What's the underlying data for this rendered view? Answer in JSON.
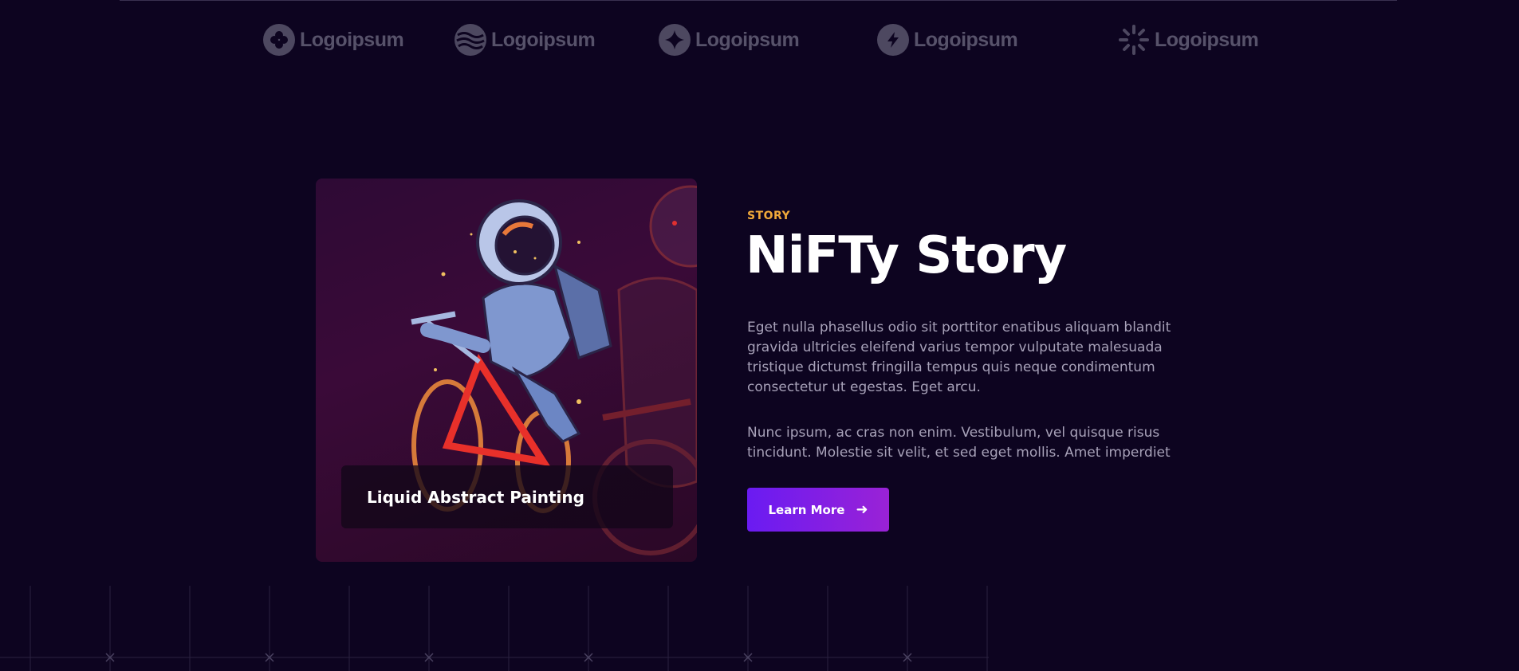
{
  "logos": [
    {
      "name": "Logoipsum",
      "icon": "clover-icon"
    },
    {
      "name": "Logoipsum",
      "icon": "waves-icon"
    },
    {
      "name": "Logoipsum",
      "icon": "star-icon"
    },
    {
      "name": "Logoipsum",
      "icon": "bolt-icon"
    },
    {
      "name": "Logoipsum",
      "icon": "sun-icon"
    }
  ],
  "card": {
    "caption": "Liquid Abstract Painting"
  },
  "story": {
    "eyebrow": "STORY",
    "title": "NiFTy Story",
    "paragraph1": "Eget nulla phasellus odio sit porttitor enatibus aliquam blandit gravida ultricies eleifend varius tempor vulputate malesuada tristique dictumst fringilla tempus quis neque condimentum consectetur ut egestas. Eget arcu.",
    "paragraph2": "Nunc ipsum, ac cras non enim. Vestibulum, vel quisque risus tincidunt. Molestie sit velit, et sed eget mollis. Amet imperdiet",
    "button_label": "Learn More",
    "button_icon": "arrow-right-icon"
  },
  "colors": {
    "background": "#0d0420",
    "accent": "#f0a93a",
    "button_start": "#6a1bf2",
    "button_end": "#9a22d6"
  }
}
